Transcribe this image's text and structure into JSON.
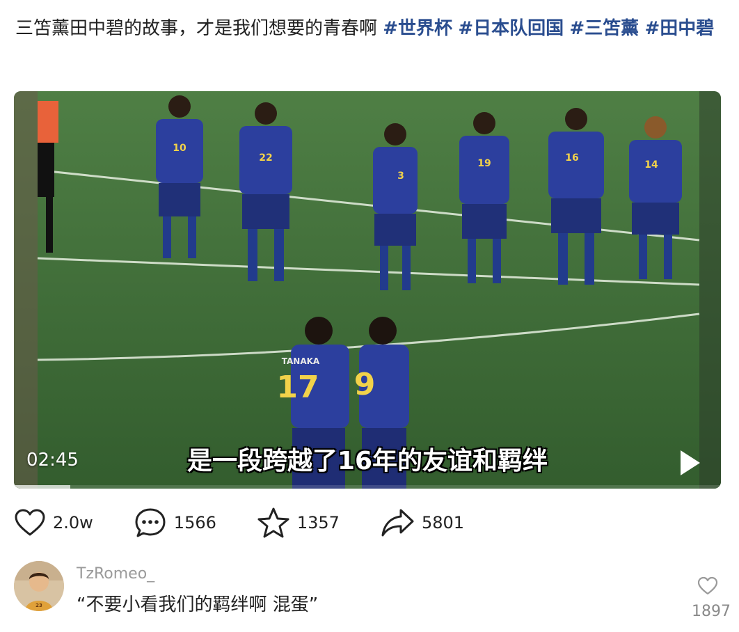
{
  "post": {
    "text": "三笘薰田中碧的故事，才是我们想要的青春啊 ",
    "tags": [
      "#世界杯",
      "#日本队回国",
      "#三笘薰",
      "#田中碧"
    ]
  },
  "video": {
    "time": "02:45",
    "subtitle": "是一段跨越了16年的友谊和羁绊",
    "progress_fraction": 0.08,
    "player_numbers": [
      "10",
      "22",
      "3",
      "19",
      "16",
      "14",
      "17",
      "9"
    ],
    "jersey_name": "TANAKA"
  },
  "actions": {
    "likes": "2.0w",
    "comments": "1566",
    "favorites": "1357",
    "shares": "5801"
  },
  "comment": {
    "user": "TzRomeo_",
    "text": "“不要小看我们的羁绊啊 混蛋”",
    "like_count": "1897"
  },
  "colors": {
    "tag": "#2a4d8f",
    "pitch": "#3d6b36",
    "jersey": "#2c3f9e"
  },
  "icons": [
    "heart-icon",
    "comment-icon",
    "star-icon",
    "share-icon",
    "play-icon"
  ]
}
